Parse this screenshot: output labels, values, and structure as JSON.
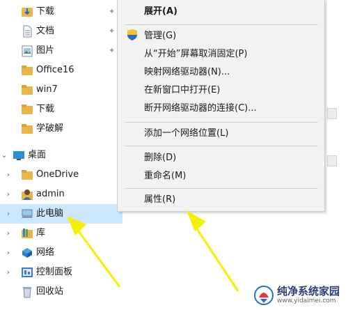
{
  "nav": {
    "items": [
      {
        "label": "下载",
        "icon": "download-folder-icon",
        "pinned": true
      },
      {
        "label": "文档",
        "icon": "documents-icon",
        "pinned": true
      },
      {
        "label": "图片",
        "icon": "pictures-icon",
        "pinned": true
      },
      {
        "label": "Office16",
        "icon": "folder-icon"
      },
      {
        "label": "win7",
        "icon": "folder-icon"
      },
      {
        "label": "下载",
        "icon": "folder-icon"
      },
      {
        "label": "学破解",
        "icon": "folder-icon"
      },
      {
        "label": "桌面",
        "icon": "desktop-icon",
        "expanded": true
      },
      {
        "label": "OneDrive",
        "icon": "folder-icon"
      },
      {
        "label": "admin",
        "icon": "user-icon"
      },
      {
        "label": "此电脑",
        "icon": "this-pc-icon",
        "selected": true
      },
      {
        "label": "库",
        "icon": "library-icon"
      },
      {
        "label": "网络",
        "icon": "network-icon"
      },
      {
        "label": "控制面板",
        "icon": "control-panel-icon"
      },
      {
        "label": "回收站",
        "icon": "recycle-bin-icon"
      }
    ]
  },
  "context_menu": {
    "expand": "展开(A)",
    "manage": "管理(G)",
    "unpin_start": "从“开始”屏幕取消固定(P)",
    "map_drive": "映射网络驱动器(N)...",
    "open_new_window": "在新窗口中打开(E)",
    "disconnect_drive": "断开网络驱动器的连接(C)...",
    "add_network_location": "添加一个网络位置(L)",
    "delete": "删除(D)",
    "rename": "重命名(M)",
    "properties": "属性(R)"
  },
  "watermark": {
    "title": "纯净系统家园",
    "url": "www.yidaimei.com"
  },
  "colors": {
    "selection": "#cce8ff",
    "folder": "#e8b64a",
    "arrow": "#f5f000",
    "menu_bg": "#f2f2f2"
  }
}
